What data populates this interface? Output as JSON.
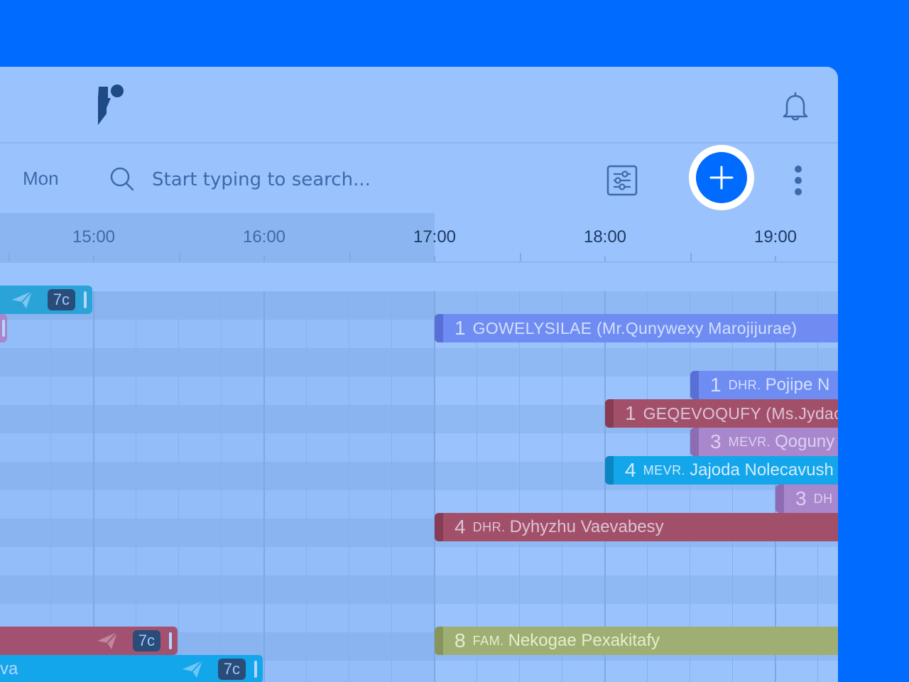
{
  "toolbar": {
    "day_label": "Mon",
    "search_placeholder": "Start typing to search..."
  },
  "timeline": {
    "hours": [
      "15:00",
      "16:00",
      "17:00",
      "18:00",
      "19:00"
    ]
  },
  "past_events": [
    {
      "badge": "7c"
    },
    {
      "badge": "7c"
    },
    {
      "badge": "7c",
      "trail": "va"
    }
  ],
  "events": [
    {
      "num": "1",
      "title": "GOWELYSILAE (Mr.Qunywexy Marojijurae)"
    },
    {
      "num": "1",
      "prefix": "DHR.",
      "name": "Pojipe N"
    },
    {
      "num": "1",
      "title": "GEQEVOQUFY (Ms.Jydac"
    },
    {
      "num": "3",
      "prefix": "MEVR.",
      "name": "Qoguny"
    },
    {
      "num": "4",
      "prefix": "MEVR.",
      "name": "Jajoda Nolecavush"
    },
    {
      "num": "3",
      "prefix": "DH",
      "name": ""
    },
    {
      "num": "4",
      "prefix": "DHR.",
      "name": "Dyhyzhu Vaevabesy"
    },
    {
      "num": "8",
      "prefix": "FAM.",
      "name": "Nekogae Pexakitafy"
    }
  ],
  "colors": {
    "background": "#006cff",
    "panel": "#9ac3fd",
    "accent": "#006cff"
  }
}
